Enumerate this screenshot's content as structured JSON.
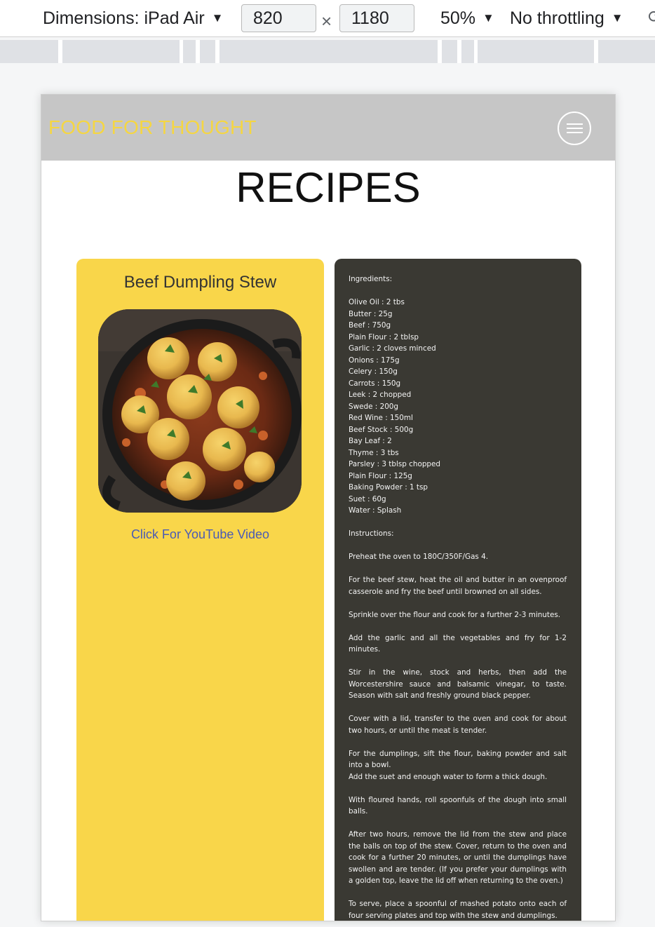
{
  "devtools": {
    "dimensions_label": "Dimensions: iPad Air",
    "width_value": "820",
    "height_value": "1180",
    "times_symbol": "×",
    "zoom": "50%",
    "throttling": "No throttling",
    "caret": "▼"
  },
  "site": {
    "brand": "FOOD FOR THOUGHT",
    "page_title": "RECIPES"
  },
  "recipe": {
    "name": "Beef Dumpling Stew",
    "video_link": "Click For YouTube Video",
    "ingredients_heading": "Ingredients:",
    "ingredients": [
      "Olive Oil : 2 tbs",
      "Butter : 25g",
      "Beef : 750g",
      "Plain Flour : 2 tblsp",
      "Garlic : 2 cloves minced",
      "Onions : 175g",
      "Celery : 150g",
      "Carrots : 150g",
      "Leek : 2 chopped",
      "Swede : 200g",
      "Red Wine : 150ml",
      "Beef Stock : 500g",
      "Bay Leaf : 2",
      "Thyme : 3 tbs",
      "Parsley : 3 tblsp chopped",
      "Plain Flour : 125g",
      "Baking Powder : 1 tsp",
      "Suet : 60g",
      "Water : Splash"
    ],
    "instructions_heading": "Instructions:",
    "steps": [
      "Preheat the oven to 180C/350F/Gas 4.",
      "For the beef stew, heat the oil and butter in an ovenproof casserole and fry the beef until browned on all sides.",
      "Sprinkle over the flour and cook for a further 2-3 minutes.",
      "Add the garlic and all the vegetables and fry for 1-2 minutes.",
      "Stir in the wine, stock and herbs, then add the Worcestershire sauce and balsamic vinegar, to taste. Season with salt and freshly ground black pepper.",
      "Cover with a lid, transfer to the oven and cook for about two hours, or until the meat is tender.",
      "For the dumplings, sift the flour, baking powder and salt into a bowl.",
      "Add the suet and enough water to form a thick dough.",
      "With floured hands, roll spoonfuls of the dough into small balls.",
      "After two hours, remove the lid from the stew and place the balls on top of the stew. Cover, return to the oven and cook for a further 20 minutes, or until the dumplings have swollen and are tender. (If you prefer your dumplings with a golden top, leave the lid off when returning to the oven.)",
      "To serve, place a spoonful of mashed potato onto each of four serving plates and top with the stew and dumplings."
    ]
  },
  "colors": {
    "nav_bg": "#c6c6c6",
    "brand": "#f5d642",
    "card_yellow": "#f9d64a",
    "card_dark": "#3a3933",
    "link": "#4a5bb5"
  }
}
